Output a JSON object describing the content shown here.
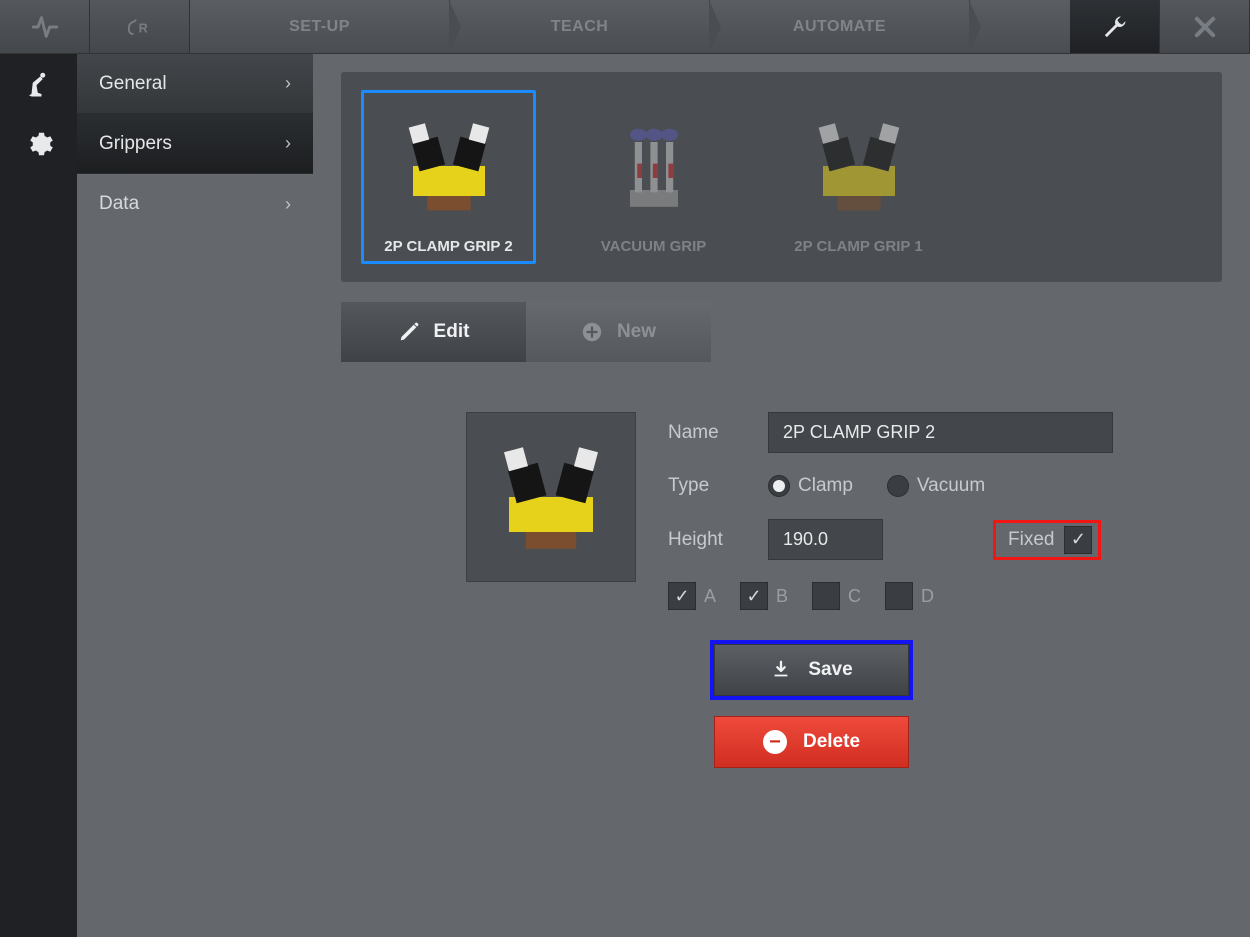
{
  "topnav": {
    "breadcrumb": [
      "SET-UP",
      "TEACH",
      "AUTOMATE"
    ]
  },
  "sidebar": {
    "items": [
      {
        "label": "General"
      },
      {
        "label": "Grippers"
      },
      {
        "label": "Data"
      }
    ]
  },
  "grippers": [
    {
      "label": "2P CLAMP GRIP 2",
      "selected": true
    },
    {
      "label": "VACUUM GRIP",
      "selected": false
    },
    {
      "label": "2P CLAMP GRIP 1",
      "selected": false
    }
  ],
  "tabs": {
    "edit": "Edit",
    "new": "New"
  },
  "form": {
    "name_lbl": "Name",
    "name_val": "2P CLAMP GRIP 2",
    "type_lbl": "Type",
    "type_clamp": "Clamp",
    "type_vacuum": "Vacuum",
    "height_lbl": "Height",
    "height_val": "190.0",
    "fixed_lbl": "Fixed",
    "fixed_checked": true,
    "opts": {
      "A": true,
      "B": true,
      "C": false,
      "D": false
    },
    "save": "Save",
    "delete": "Delete"
  }
}
